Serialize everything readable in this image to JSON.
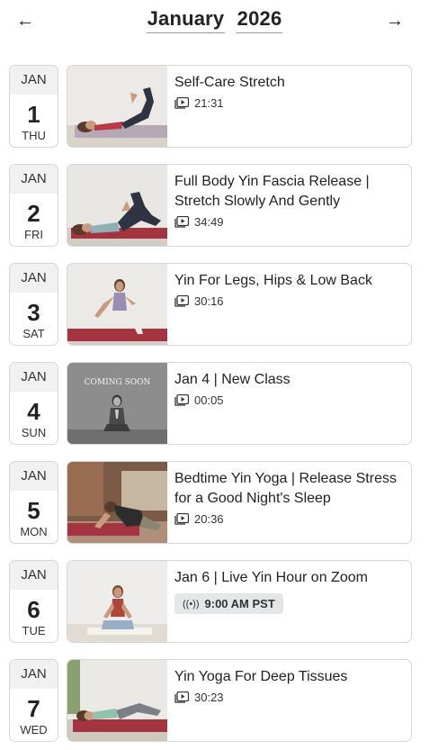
{
  "header": {
    "prev_icon": "arrow-left-icon",
    "next_icon": "arrow-right-icon",
    "prev_glyph": "←",
    "next_glyph": "→",
    "month": "January",
    "year": "2026"
  },
  "entries": [
    {
      "month": "JAN",
      "day": "1",
      "dow": "THU",
      "title": "Self-Care Stretch",
      "duration": "21:31",
      "kind": "video"
    },
    {
      "month": "JAN",
      "day": "2",
      "dow": "FRI",
      "title": "Full Body Yin Fascia Release | Stretch Slowly And Gently",
      "duration": "34:49",
      "kind": "video"
    },
    {
      "month": "JAN",
      "day": "3",
      "dow": "SAT",
      "title": "Yin For Legs, Hips & Low Back",
      "duration": "30:16",
      "kind": "video"
    },
    {
      "month": "JAN",
      "day": "4",
      "dow": "SUN",
      "title": "Jan 4 | New Class",
      "duration": "00:05",
      "kind": "video",
      "thumb_text": "COMING SOON"
    },
    {
      "month": "JAN",
      "day": "5",
      "dow": "MON",
      "title": "Bedtime Yin Yoga | Release Stress for a Good Night's Sleep",
      "duration": "20:36",
      "kind": "video"
    },
    {
      "month": "JAN",
      "day": "6",
      "dow": "TUE",
      "title": "Jan 6 | Live Yin Hour on Zoom",
      "live_time": "9:00 AM PST",
      "live_glyph": "((•))",
      "kind": "live"
    },
    {
      "month": "JAN",
      "day": "7",
      "dow": "WED",
      "title": "Yin Yoga For Deep Tissues",
      "duration": "30:23",
      "kind": "video"
    }
  ],
  "colors": {
    "mat": "#a4343f",
    "wall": "#e8e6e3",
    "floor": "#cfc9c1",
    "skin": "#c99a7e",
    "hair": "#5a3a2a",
    "top": "#b83a44",
    "pants": "#2e3442"
  }
}
